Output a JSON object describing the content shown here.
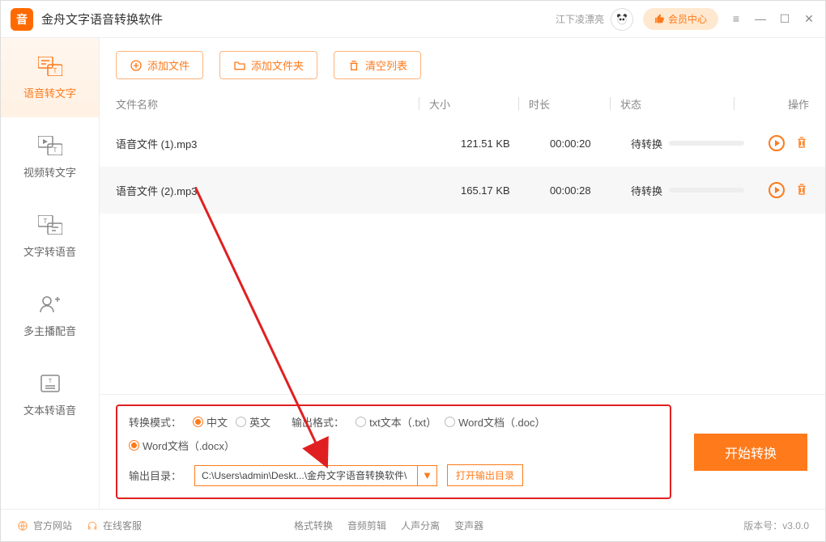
{
  "app": {
    "title": "金舟文字语音转换软件",
    "user": "江下凌漂亮",
    "vip_label": "会员中心",
    "version_label": "版本号：v3.0.0"
  },
  "sidebar": {
    "items": [
      {
        "label": "语音转文字"
      },
      {
        "label": "视频转文字"
      },
      {
        "label": "文字转语音"
      },
      {
        "label": "多主播配音"
      },
      {
        "label": "文本转语音"
      }
    ]
  },
  "toolbar": {
    "add_file": "添加文件",
    "add_folder": "添加文件夹",
    "clear_list": "清空列表"
  },
  "table": {
    "headers": {
      "name": "文件名称",
      "size": "大小",
      "duration": "时长",
      "status": "状态",
      "ops": "操作"
    },
    "rows": [
      {
        "name": "语音文件 (1).mp3",
        "size": "121.51 KB",
        "duration": "00:00:20",
        "status": "待转换"
      },
      {
        "name": "语音文件 (2).mp3",
        "size": "165.17 KB",
        "duration": "00:00:28",
        "status": "待转换"
      }
    ]
  },
  "options": {
    "mode_label": "转换模式：",
    "mode_cn": "中文",
    "mode_en": "英文",
    "format_label": "输出格式：",
    "fmt_txt": "txt文本（.txt）",
    "fmt_doc": "Word文档（.doc）",
    "fmt_docx": "Word文档（.docx）",
    "outdir_label": "输出目录：",
    "outdir_path": "C:\\Users\\admin\\Deskt...\\金舟文字语音转换软件\\",
    "open_dir": "打开输出目录",
    "convert": "开始转换"
  },
  "statusbar": {
    "website": "官方网站",
    "support": "在线客服",
    "links": [
      "格式转换",
      "音频剪辑",
      "人声分离",
      "变声器"
    ]
  }
}
